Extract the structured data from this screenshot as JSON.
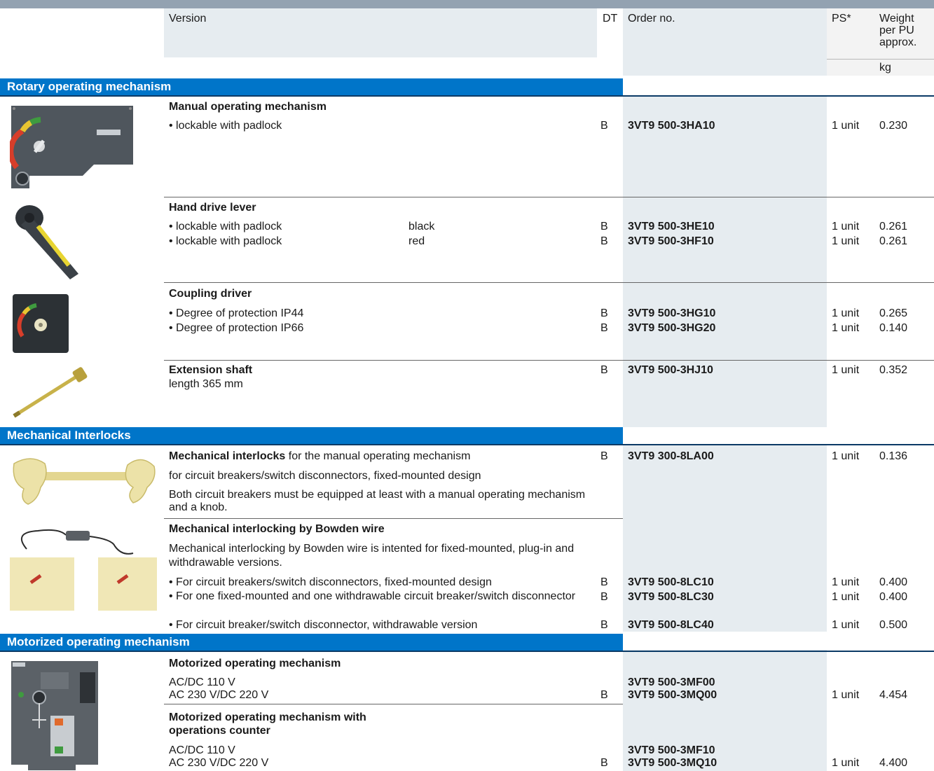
{
  "header": {
    "version": "Version",
    "dt": "DT",
    "order_no": "Order no.",
    "ps": "PS*",
    "weight_line1": "Weight",
    "weight_line2": "per PU",
    "weight_line3": "approx.",
    "weight_unit": "kg"
  },
  "sections": {
    "rotary": "Rotary operating mechanism",
    "interlocks": "Mechanical Interlocks",
    "motorized": "Motorized operating mechanism"
  },
  "products": {
    "manual": {
      "title": "Manual operating mechanism",
      "rows": [
        {
          "desc": "• lockable with padlock",
          "dt": "B",
          "order": "3VT9 500-3HA10",
          "ps": "1 unit",
          "weight": "0.230"
        }
      ]
    },
    "lever": {
      "title": "Hand drive lever",
      "rows": [
        {
          "desc": "• lockable with padlock",
          "color": "black",
          "dt": "B",
          "order": "3VT9 500-3HE10",
          "ps": "1 unit",
          "weight": "0.261"
        },
        {
          "desc": "• lockable with padlock",
          "color": "red",
          "dt": "B",
          "order": "3VT9 500-3HF10",
          "ps": "1 unit",
          "weight": "0.261"
        }
      ]
    },
    "coupling": {
      "title": "Coupling driver",
      "rows": [
        {
          "desc": "• Degree of protection IP44",
          "dt": "B",
          "order": "3VT9 500-3HG10",
          "ps": "1 unit",
          "weight": "0.265"
        },
        {
          "desc": "• Degree of protection IP66",
          "dt": "B",
          "order": "3VT9 500-3HG20",
          "ps": "1 unit",
          "weight": "0.140"
        }
      ]
    },
    "shaft": {
      "title": "Extension shaft",
      "subtitle": "length 365 mm",
      "dt": "B",
      "order": "3VT9 500-3HJ10",
      "ps": "1 unit",
      "weight": "0.352"
    },
    "interlock": {
      "title": "Mechanical interlocks",
      "title_rest": " for the manual operating mechanism",
      "line2": "for circuit breakers/switch disconnectors, fixed-mounted design",
      "line3": "Both circuit breakers must be equipped at least with a manual operating mechanism and a knob.",
      "dt": "B",
      "order": "3VT9 300-8LA00",
      "ps": "1 unit",
      "weight": "0.136"
    },
    "bowden": {
      "title": "Mechanical interlocking by Bowden wire",
      "intro": "Mechanical interlocking by Bowden wire is intented for fixed-mounted, plug-in and withdrawable versions.",
      "rows": [
        {
          "desc": "• For circuit breakers/switch disconnectors, fixed-mounted design",
          "dt": "B",
          "order": "3VT9 500-8LC10",
          "ps": "1 unit",
          "weight": "0.400"
        },
        {
          "desc": "• For one fixed-mounted and one withdrawable circuit breaker/switch disconnector",
          "dt": "B",
          "order": "3VT9 500-8LC30",
          "ps": "1 unit",
          "weight": "0.400"
        },
        {
          "desc": "• For circuit breaker/switch disconnector, withdrawable version",
          "dt": "B",
          "order": "3VT9 500-8LC40",
          "ps": "1 unit",
          "weight": "0.500"
        }
      ]
    },
    "motor": {
      "title": "Motorized operating mechanism",
      "rows": [
        {
          "desc": "AC/DC 110 V",
          "dt": "",
          "order": "3VT9 500-3MF00",
          "ps": "",
          "weight": ""
        },
        {
          "desc": "AC 230 V/DC 220 V",
          "dt": "B",
          "order": "3VT9 500-3MQ00",
          "ps": "1 unit",
          "weight": "4.454"
        }
      ]
    },
    "motor_counter": {
      "title": "Motorized operating mechanism with operations counter",
      "rows": [
        {
          "desc": "AC/DC 110 V",
          "dt": "",
          "order": "3VT9 500-3MF10",
          "ps": "",
          "weight": ""
        },
        {
          "desc": "AC 230 V/DC 220 V",
          "dt": "B",
          "order": "3VT9 500-3MQ10",
          "ps": "1 unit",
          "weight": "4.400"
        }
      ]
    }
  }
}
